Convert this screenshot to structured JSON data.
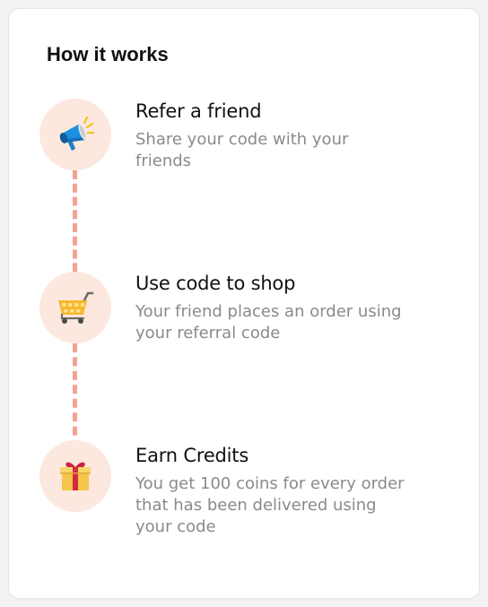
{
  "section": {
    "title": "How it works"
  },
  "steps": [
    {
      "title": "Refer a friend",
      "description": "Share your code with your friends",
      "icon": "megaphone-icon"
    },
    {
      "title": "Use code to shop",
      "description": "Your friend places an order using your referral code",
      "icon": "shopping-cart-icon"
    },
    {
      "title": "Earn Credits",
      "description": "You get 100 coins for every order that has been delivered using your code",
      "icon": "gift-icon"
    }
  ],
  "colors": {
    "icon_background": "#fde8df",
    "connector": "#f4a293",
    "title_text": "#111111",
    "description_text": "#8a8a8a"
  }
}
